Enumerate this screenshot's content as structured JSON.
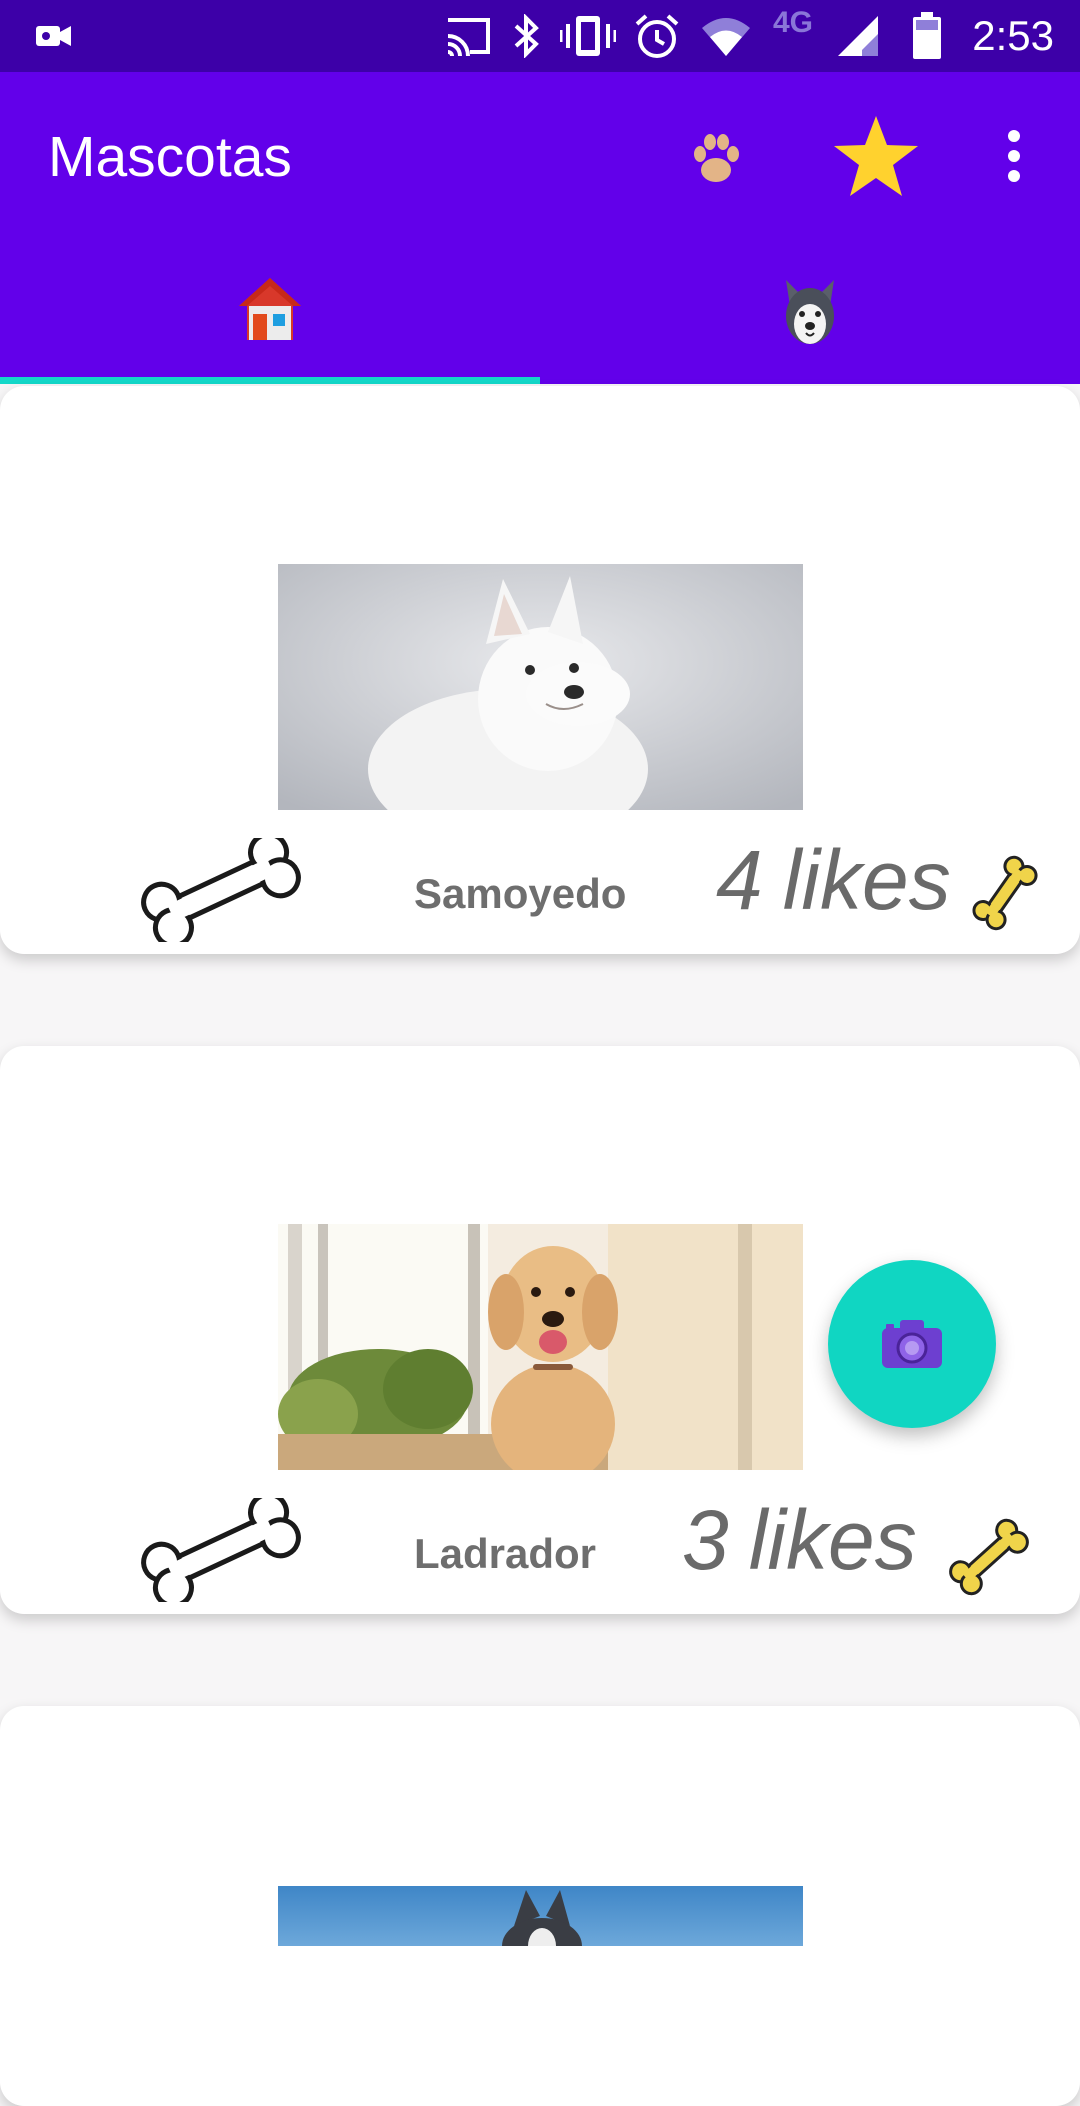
{
  "status_bar": {
    "time": "2:53",
    "network_type": "4G",
    "icons": [
      "video-record-icon",
      "cast-icon",
      "bluetooth-icon",
      "vibrate-icon",
      "alarm-icon",
      "wifi-icon",
      "signal-icon",
      "battery-icon"
    ]
  },
  "app_bar": {
    "title": "Mascotas",
    "actions": [
      "paw-icon",
      "star-icon",
      "more-vert-icon"
    ]
  },
  "tabs": [
    {
      "icon": "home-icon",
      "selected": true
    },
    {
      "icon": "husky-icon",
      "selected": false
    }
  ],
  "pets": [
    {
      "name": "Samoyedo",
      "likes_count": "4",
      "likes_unit": "likes",
      "photo": "white-samoyed-dog-photo"
    },
    {
      "name": "Ladrador",
      "likes_count": "3",
      "likes_unit": "likes",
      "photo": "golden-retriever-dog-photo"
    },
    {
      "photo": "husky-dog-photo"
    }
  ],
  "fab": {
    "icon": "camera-icon"
  },
  "colors": {
    "status_bar": "#3d00a8",
    "app_bar": "#6200ea",
    "tab_indicator": "#14d8c9",
    "fab": "#10d6c2",
    "background": "#f7f6f7"
  }
}
